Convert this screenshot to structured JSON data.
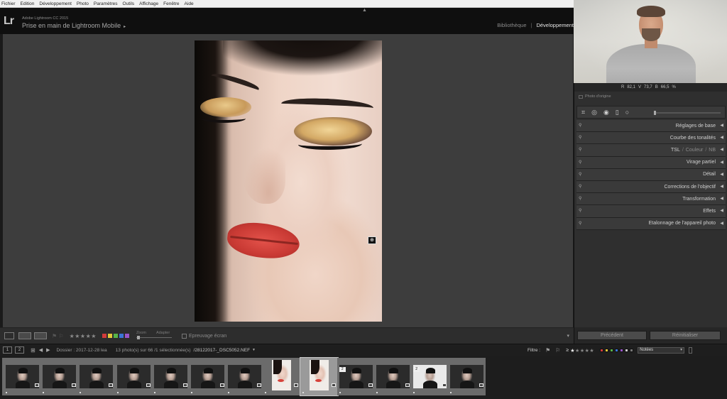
{
  "menubar": {
    "items": [
      "Fichier",
      "Edition",
      "Développement",
      "Photo",
      "Paramètres",
      "Outils",
      "Affichage",
      "Fenêtre",
      "Aide"
    ]
  },
  "identity": {
    "app_name": "Adobe Lightroom CC 2015",
    "catalog_name": "Prise en main de Lightroom Mobile",
    "catalog_arrow": "▸"
  },
  "modules": {
    "items": [
      "Bibliothèque",
      "Développement"
    ],
    "separator": "|",
    "active_index": 1
  },
  "toolbar": {
    "stars": "★★★★★",
    "zoom_label": "Zoom",
    "zoom_value": "Adapter",
    "softproof_label": "Epreuvage écran",
    "colors": [
      "#d23b3b",
      "#e3c83a",
      "#57b447",
      "#3b74d6",
      "#9a55c9"
    ]
  },
  "right_panel": {
    "readout": {
      "r_label": "R",
      "r": "82,1",
      "g_label": "V",
      "g": "73,7",
      "b_label": "B",
      "b": "66,5",
      "unit": "%"
    },
    "original_photo": "Photo d'origine",
    "panels": [
      {
        "label": "Réglages de base"
      },
      {
        "label": "Courbe des tonalités"
      },
      {
        "label": "TSL",
        "sep1": "/",
        "label2": "Couleur",
        "sep2": "/",
        "label3": "NB"
      },
      {
        "label": "Virage partiel"
      },
      {
        "label": "Détail"
      },
      {
        "label": "Corrections de l'objectif"
      },
      {
        "label": "Transformation"
      },
      {
        "label": "Effets"
      },
      {
        "label": "Etalonnage de l'appareil photo"
      }
    ],
    "prev_button": "Précédent",
    "reset_button": "Réinitialiser"
  },
  "filmstrip_header": {
    "page1": "1",
    "page2": "2",
    "folder": "Dossier : 2017-12-28 lea",
    "count": "13 photo(s) sur 66 /1 sélectionnée(s)",
    "file": "/28122017-_DSC5052.NEF",
    "filter_label": "Filtre :",
    "ge": "≥",
    "filter_stars": "★★★★★",
    "filter_select": "Notées",
    "filter_colors": [
      "#d23b3b",
      "#e3c83a",
      "#57b447",
      "#3b74d6",
      "#9a55c9",
      "#cccccc",
      "#777777"
    ]
  },
  "filmstrip": {
    "thumbs": [
      {
        "type": "dark"
      },
      {
        "type": "dark"
      },
      {
        "type": "dark"
      },
      {
        "type": "dark"
      },
      {
        "type": "dark"
      },
      {
        "type": "dark"
      },
      {
        "type": "dark"
      },
      {
        "type": "portrait"
      },
      {
        "type": "portrait",
        "state": "selected"
      },
      {
        "type": "dark",
        "number": "2"
      },
      {
        "type": "dark"
      },
      {
        "type": "light",
        "number": "2"
      },
      {
        "type": "dark"
      }
    ]
  }
}
